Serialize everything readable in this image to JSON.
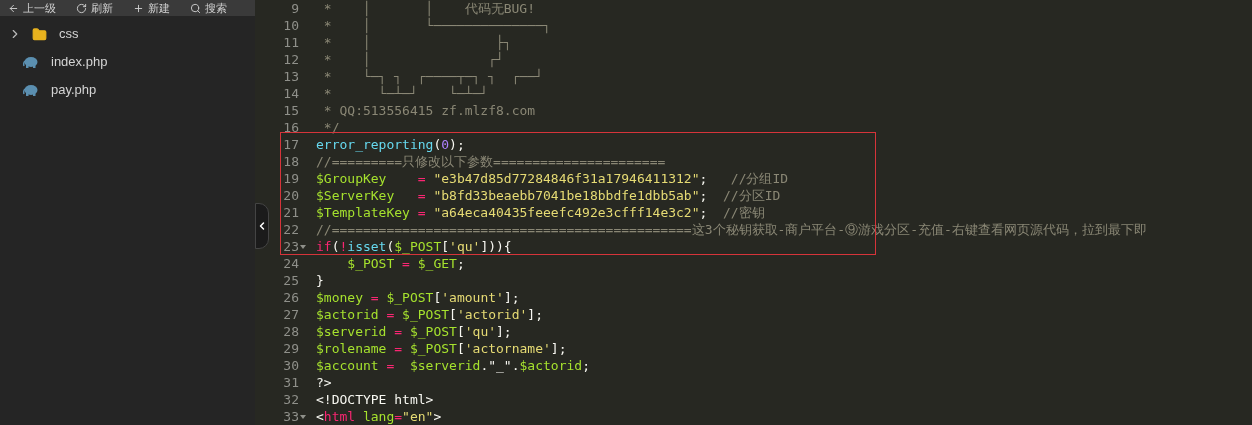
{
  "toolbar": [
    {
      "label": "上一级",
      "kind": "up"
    },
    {
      "label": "刷新",
      "kind": "refresh"
    },
    {
      "label": "新建",
      "kind": "new"
    },
    {
      "label": "搜索",
      "kind": "search"
    }
  ],
  "files": [
    {
      "name": "css",
      "kind": "folder",
      "expanded": false
    },
    {
      "name": "index.php",
      "kind": "php"
    },
    {
      "name": "pay.php",
      "kind": "php"
    }
  ],
  "editor": {
    "lines": [
      {
        "number": "9",
        "fold": false,
        "tokens": [
          {
            "kind": "cmt",
            "s": " *    │       │    代码无BUG!"
          }
        ]
      },
      {
        "number": "10",
        "fold": false,
        "tokens": [
          {
            "kind": "cmt",
            "s": " *    │       └──────────────┐"
          }
        ]
      },
      {
        "number": "11",
        "fold": false,
        "tokens": [
          {
            "kind": "cmt",
            "s": " *    │                ├┐"
          }
        ]
      },
      {
        "number": "12",
        "fold": false,
        "tokens": [
          {
            "kind": "cmt",
            "s": " *    │               ┌┘"
          }
        ]
      },
      {
        "number": "13",
        "fold": false,
        "tokens": [
          {
            "kind": "cmt",
            "s": " *    └─┐ ┐  ┌────┬─┐ ┐  ┌──┘"
          }
        ]
      },
      {
        "number": "14",
        "fold": false,
        "tokens": [
          {
            "kind": "cmt",
            "s": " *      └─┴─┘    └─┴─┘"
          }
        ]
      },
      {
        "number": "15",
        "fold": false,
        "tokens": [
          {
            "kind": "cmt",
            "s": " * QQ:513556415 zf.mlzf8.com"
          }
        ]
      },
      {
        "number": "16",
        "fold": false,
        "tokens": [
          {
            "kind": "cmt",
            "s": " */"
          }
        ]
      },
      {
        "number": "17",
        "fold": false,
        "tokens": [
          {
            "kind": "fn",
            "s": "error_reporting"
          },
          {
            "kind": "plain",
            "s": "("
          },
          {
            "kind": "num",
            "s": "0"
          },
          {
            "kind": "plain",
            "s": ");"
          }
        ]
      },
      {
        "number": "18",
        "fold": false,
        "tokens": [
          {
            "kind": "cmt",
            "s": "//=========只修改以下参数======================"
          }
        ]
      },
      {
        "number": "19",
        "fold": false,
        "tokens": [
          {
            "kind": "var",
            "s": "$GroupKey    "
          },
          {
            "kind": "op",
            "s": "="
          },
          {
            "kind": "str",
            "s": " \"e3b47d85d77284846f31a17946411312\""
          },
          {
            "kind": "plain",
            "s": ";   "
          },
          {
            "kind": "cmt",
            "s": "//分组ID"
          }
        ]
      },
      {
        "number": "20",
        "fold": false,
        "tokens": [
          {
            "kind": "var",
            "s": "$ServerKey   "
          },
          {
            "kind": "op",
            "s": "="
          },
          {
            "kind": "str",
            "s": " \"b8fd33beaebb7041be18bbdfe1dbb5ab\""
          },
          {
            "kind": "plain",
            "s": ";  "
          },
          {
            "kind": "cmt",
            "s": "//分区ID"
          }
        ]
      },
      {
        "number": "21",
        "fold": false,
        "tokens": [
          {
            "kind": "var",
            "s": "$TemplateKey "
          },
          {
            "kind": "op",
            "s": "="
          },
          {
            "kind": "str",
            "s": " \"a64eca40435feeefc492e3cfff14e3c2\""
          },
          {
            "kind": "plain",
            "s": ";  "
          },
          {
            "kind": "cmt",
            "s": "//密钥"
          }
        ]
      },
      {
        "number": "22",
        "fold": false,
        "tokens": [
          {
            "kind": "cmt",
            "s": "//==============================================这3个秘钥获取-商户平台-⑨游戏分区-充值-右键查看网页源代码，拉到最下即"
          }
        ]
      },
      {
        "number": "23",
        "fold": true,
        "tokens": [
          {
            "kind": "kw",
            "s": "if"
          },
          {
            "kind": "plain",
            "s": "("
          },
          {
            "kind": "op",
            "s": "!"
          },
          {
            "kind": "fn",
            "s": "isset"
          },
          {
            "kind": "plain",
            "s": "("
          },
          {
            "kind": "var",
            "s": "$_POST"
          },
          {
            "kind": "plain",
            "s": "["
          },
          {
            "kind": "str",
            "s": "'qu'"
          },
          {
            "kind": "plain",
            "s": "])){"
          }
        ]
      },
      {
        "number": "24",
        "fold": false,
        "tokens": [
          {
            "kind": "var",
            "s": "    $_POST "
          },
          {
            "kind": "op",
            "s": "="
          },
          {
            "kind": "var",
            "s": " $_GET"
          },
          {
            "kind": "plain",
            "s": ";"
          }
        ]
      },
      {
        "number": "25",
        "fold": false,
        "tokens": [
          {
            "kind": "plain",
            "s": "}"
          }
        ]
      },
      {
        "number": "26",
        "fold": false,
        "tokens": [
          {
            "kind": "var",
            "s": "$money "
          },
          {
            "kind": "op",
            "s": "="
          },
          {
            "kind": "var",
            "s": " $_POST"
          },
          {
            "kind": "plain",
            "s": "["
          },
          {
            "kind": "str",
            "s": "'amount'"
          },
          {
            "kind": "plain",
            "s": "];"
          }
        ]
      },
      {
        "number": "27",
        "fold": false,
        "tokens": [
          {
            "kind": "var",
            "s": "$actorid "
          },
          {
            "kind": "op",
            "s": "="
          },
          {
            "kind": "var",
            "s": " $_POST"
          },
          {
            "kind": "plain",
            "s": "["
          },
          {
            "kind": "str",
            "s": "'actorid'"
          },
          {
            "kind": "plain",
            "s": "];"
          }
        ]
      },
      {
        "number": "28",
        "fold": false,
        "tokens": [
          {
            "kind": "var",
            "s": "$serverid "
          },
          {
            "kind": "op",
            "s": "="
          },
          {
            "kind": "var",
            "s": " $_POST"
          },
          {
            "kind": "plain",
            "s": "["
          },
          {
            "kind": "str",
            "s": "'qu'"
          },
          {
            "kind": "plain",
            "s": "];"
          }
        ]
      },
      {
        "number": "29",
        "fold": false,
        "tokens": [
          {
            "kind": "var",
            "s": "$rolename "
          },
          {
            "kind": "op",
            "s": "="
          },
          {
            "kind": "var",
            "s": " $_POST"
          },
          {
            "kind": "plain",
            "s": "["
          },
          {
            "kind": "str",
            "s": "'actorname'"
          },
          {
            "kind": "plain",
            "s": "];"
          }
        ]
      },
      {
        "number": "30",
        "fold": false,
        "tokens": [
          {
            "kind": "var",
            "s": "$account "
          },
          {
            "kind": "op",
            "s": "="
          },
          {
            "kind": "var",
            "s": "  $serverid"
          },
          {
            "kind": "plain",
            "s": ".\"_\"."
          },
          {
            "kind": "var",
            "s": "$actorid"
          },
          {
            "kind": "plain",
            "s": ";"
          }
        ]
      },
      {
        "number": "31",
        "fold": false,
        "tokens": [
          {
            "kind": "plain",
            "s": "?>"
          }
        ]
      },
      {
        "number": "32",
        "fold": false,
        "tokens": [
          {
            "kind": "plain",
            "s": "<!DOCTYPE html>"
          }
        ]
      },
      {
        "number": "33",
        "fold": true,
        "tokens": [
          {
            "kind": "plain",
            "s": "<"
          },
          {
            "kind": "tag",
            "s": "html "
          },
          {
            "kind": "attr",
            "s": "lang"
          },
          {
            "kind": "op",
            "s": "="
          },
          {
            "kind": "str",
            "s": "\"en\""
          },
          {
            "kind": "plain",
            "s": ">"
          }
        ]
      }
    ]
  }
}
